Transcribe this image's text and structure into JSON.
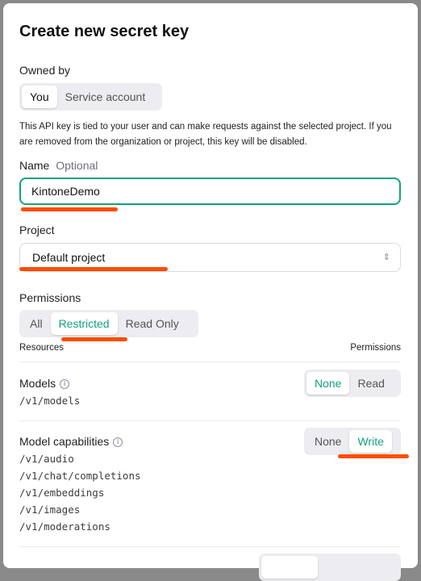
{
  "dialog": {
    "title": "Create new secret key",
    "owned_by": {
      "label": "Owned by",
      "options": [
        "You",
        "Service account"
      ],
      "selected": "You"
    },
    "help_text": "This API key is tied to your user and can make requests against the selected project. If you are removed from the organization or project, this key will be disabled.",
    "name": {
      "label": "Name",
      "optional": "Optional",
      "value": "KintoneDemo"
    },
    "project": {
      "label": "Project",
      "value": "Default project"
    },
    "permissions": {
      "label": "Permissions",
      "options": [
        "All",
        "Restricted",
        "Read Only"
      ],
      "selected": "Restricted"
    },
    "table": {
      "col_resources": "Resources",
      "col_permissions": "Permissions",
      "rows": [
        {
          "name": "Models",
          "endpoints": [
            "/v1/models"
          ],
          "options": [
            "None",
            "Read"
          ],
          "selected": "None"
        },
        {
          "name": "Model capabilities",
          "endpoints": [
            "/v1/audio",
            "/v1/chat/completions",
            "/v1/embeddings",
            "/v1/images",
            "/v1/moderations"
          ],
          "options": [
            "None",
            "Write"
          ],
          "selected": "Write"
        }
      ]
    }
  },
  "colors": {
    "accent": "#10a37f",
    "annotation": "#ff4d00"
  }
}
